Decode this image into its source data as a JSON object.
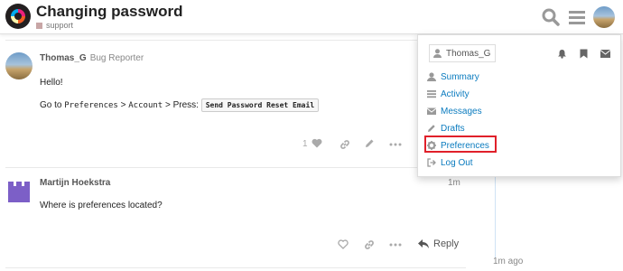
{
  "header": {
    "title": "Changing password",
    "category": "support"
  },
  "posts": [
    {
      "username": "Thomas_G",
      "user_title": "Bug Reporter",
      "line1": "Hello!",
      "line2_prefix": "Go to ",
      "path1": "Preferences",
      "sep1": " > ",
      "path2": "Account",
      "sep2": " > Press: ",
      "button_text": "Send Password Reset Email",
      "like_count": "1"
    },
    {
      "username": "Martijn Hoekstra",
      "time": "1m",
      "body": "Where is preferences located?",
      "reply_label": "Reply"
    }
  ],
  "timeline": {
    "time": "1m ago"
  },
  "user_menu": {
    "tab_label": "Thomas_G",
    "items": [
      {
        "label": "Summary",
        "icon": "user-icon"
      },
      {
        "label": "Activity",
        "icon": "list-icon"
      },
      {
        "label": "Messages",
        "icon": "envelope-icon"
      },
      {
        "label": "Drafts",
        "icon": "pencil-icon"
      },
      {
        "label": "Preferences",
        "icon": "gear-icon"
      },
      {
        "label": "Log Out",
        "icon": "sign-out-icon"
      }
    ]
  },
  "colors": {
    "link": "#0a7bbf",
    "highlight": "#e0202a",
    "category": "#c8a6a6"
  }
}
